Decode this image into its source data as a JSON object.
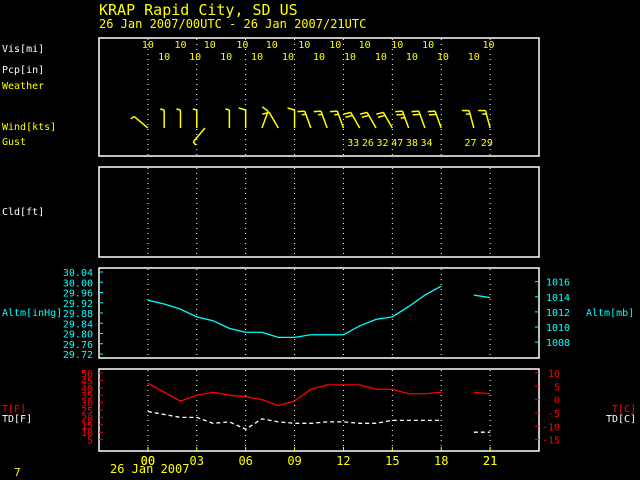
{
  "header": {
    "station": "KRAP  Rapid City, SD US",
    "period": "26 Jan 2007/00UTC - 26 Jan 2007/21UTC"
  },
  "row_labels": {
    "vis": "Vis[mi]",
    "pcp": "Pcp[in]",
    "weather": "Weather",
    "wind": "Wind[kts]",
    "gust": "Gust",
    "cld": "Cld[ft]",
    "altm_left": "Altm[inHg]",
    "altm_right": "Altm[mb]",
    "temp_f": "T[F]",
    "dewp_f": "TD[F]",
    "temp_c": "T[C]",
    "dewp_c": "TD[C]"
  },
  "footer": {
    "date": "26 Jan 2007",
    "page": "7"
  },
  "colors": {
    "frame": "#ffffff",
    "grid": "#ffffff",
    "yellow": "#ffff00",
    "cyan": "#00ffff",
    "red": "#ff0000",
    "white": "#ffffff",
    "bg": "#000000"
  },
  "chart_data": [
    {
      "type": "table",
      "x_hours": [
        21,
        0,
        3,
        6,
        9,
        12,
        15,
        18,
        21,
        0
      ],
      "x_ticks": [
        "21",
        "00",
        "03",
        "06",
        "09",
        "12",
        "15",
        "18",
        "21",
        "00"
      ],
      "vis_upper": [
        {
          "hour": 0,
          "v": "10"
        },
        {
          "hour": 2,
          "v": "10"
        },
        {
          "hour": 3.8,
          "v": "10"
        },
        {
          "hour": 5.8,
          "v": "10"
        },
        {
          "hour": 7.6,
          "v": "10"
        },
        {
          "hour": 9.6,
          "v": "10"
        },
        {
          "hour": 11.5,
          "v": "10"
        },
        {
          "hour": 13.3,
          "v": "10"
        },
        {
          "hour": 15.3,
          "v": "10"
        },
        {
          "hour": 17.2,
          "v": "10"
        },
        {
          "hour": 20.9,
          "v": "10"
        }
      ],
      "vis_lower": [
        {
          "hour": 1,
          "v": "10"
        },
        {
          "hour": 2.9,
          "v": "10"
        },
        {
          "hour": 4.8,
          "v": "10"
        },
        {
          "hour": 6.7,
          "v": "10"
        },
        {
          "hour": 8.6,
          "v": "10"
        },
        {
          "hour": 10.5,
          "v": "10"
        },
        {
          "hour": 12.4,
          "v": "10"
        },
        {
          "hour": 14.3,
          "v": "10"
        },
        {
          "hour": 16.2,
          "v": "10"
        },
        {
          "hour": 18.1,
          "v": "10"
        },
        {
          "hour": 20,
          "v": "10"
        }
      ],
      "wind": [
        {
          "hour": 0,
          "dir": 310,
          "spd": 5
        },
        {
          "hour": 1,
          "dir": 360,
          "spd": 5
        },
        {
          "hour": 2,
          "dir": 360,
          "spd": 5
        },
        {
          "hour": 3,
          "dir": 360,
          "spd": 5
        },
        {
          "hour": 3.5,
          "dir": 220,
          "spd": 5
        },
        {
          "hour": 5,
          "dir": 360,
          "spd": 5
        },
        {
          "hour": 6,
          "dir": 360,
          "spd": 10
        },
        {
          "hour": 7,
          "dir": 20,
          "spd": 10
        },
        {
          "hour": 8,
          "dir": 330,
          "spd": 10
        },
        {
          "hour": 9,
          "dir": 360,
          "spd": 10
        },
        {
          "hour": 10,
          "dir": 340,
          "spd": 15
        },
        {
          "hour": 11,
          "dir": 340,
          "spd": 15
        },
        {
          "hour": 12,
          "dir": 340,
          "spd": 15
        },
        {
          "hour": 13,
          "dir": 330,
          "spd": 20
        },
        {
          "hour": 14,
          "dir": 330,
          "spd": 20
        },
        {
          "hour": 15,
          "dir": 330,
          "spd": 20
        },
        {
          "hour": 16,
          "dir": 340,
          "spd": 25
        },
        {
          "hour": 17,
          "dir": 340,
          "spd": 20
        },
        {
          "hour": 18,
          "dir": 340,
          "spd": 20
        },
        {
          "hour": 20,
          "dir": 345,
          "spd": 15
        },
        {
          "hour": 21,
          "dir": 345,
          "spd": 15
        }
      ],
      "gust": [
        {
          "hour": 12.6,
          "v": "33"
        },
        {
          "hour": 13.5,
          "v": "26"
        },
        {
          "hour": 14.4,
          "v": "32"
        },
        {
          "hour": 15.3,
          "v": "47"
        },
        {
          "hour": 16.2,
          "v": "38"
        },
        {
          "hour": 17.1,
          "v": "34"
        },
        {
          "hour": 19.8,
          "v": "27"
        },
        {
          "hour": 20.8,
          "v": "29"
        }
      ]
    },
    {
      "type": "line",
      "title": "Altm[inHg]",
      "x_range": [
        -3,
        24
      ],
      "ylim": [
        29.72,
        30.04
      ],
      "y_ticks": [
        "30.04",
        "30.00",
        "29.96",
        "29.92",
        "29.88",
        "29.84",
        "29.80",
        "29.76",
        "29.72"
      ],
      "y2_ticks": [
        "1016",
        "1014",
        "1012",
        "1010",
        "1008"
      ],
      "y2_values": [
        1016,
        1014,
        1012,
        1010,
        1008
      ],
      "series": [
        {
          "name": "Altm[inHg]",
          "x": [
            0,
            1,
            2,
            3,
            4,
            5,
            6,
            7,
            8,
            9,
            10,
            11,
            12,
            13,
            14,
            15,
            16,
            17,
            18
          ],
          "y": [
            29.93,
            29.915,
            29.895,
            29.865,
            29.85,
            29.82,
            29.805,
            29.805,
            29.785,
            29.785,
            29.795,
            29.795,
            29.795,
            29.83,
            29.855,
            29.865,
            29.905,
            29.95,
            29.985
          ]
        },
        {
          "name": "Altm[inHg]-2",
          "x": [
            20,
            21
          ],
          "y": [
            29.95,
            29.94
          ]
        }
      ]
    },
    {
      "type": "line",
      "title": "T[F] / TD[F]",
      "x_range": [
        -3,
        24
      ],
      "ylim": [
        0,
        50
      ],
      "y_ticks": [
        "50",
        "45",
        "40",
        "35",
        "30",
        "25",
        "20",
        "15",
        "10",
        "5"
      ],
      "y2_ticks": [
        "10",
        "5",
        "0",
        "-5",
        "-10",
        "-15"
      ],
      "y2_values": [
        10,
        5,
        0,
        -5,
        -10,
        -15
      ],
      "series": [
        {
          "name": "T[F]",
          "x": [
            0,
            1,
            2,
            3,
            4,
            5,
            6,
            7,
            8,
            9,
            10,
            11,
            12,
            13,
            14,
            15,
            16,
            17,
            18
          ],
          "y": [
            43,
            37,
            31,
            35,
            37,
            35,
            34,
            32,
            28,
            31,
            39,
            42,
            42,
            42,
            39,
            39,
            36,
            36,
            37
          ]
        },
        {
          "name": "T[F]-2",
          "x": [
            20,
            21
          ],
          "y": [
            37,
            36
          ]
        },
        {
          "name": "TD[F]",
          "x": [
            0,
            1,
            2,
            3,
            4,
            5,
            6,
            7,
            8,
            9,
            10,
            11,
            12,
            13,
            14,
            15,
            16,
            17,
            18
          ],
          "y": [
            24,
            22,
            20,
            20,
            16,
            17,
            12,
            19,
            17,
            16,
            16,
            17,
            17,
            16,
            16,
            18,
            18,
            18,
            18
          ]
        },
        {
          "name": "TD[F]-2",
          "x": [
            20,
            21
          ],
          "y": [
            10,
            10
          ]
        }
      ]
    }
  ]
}
